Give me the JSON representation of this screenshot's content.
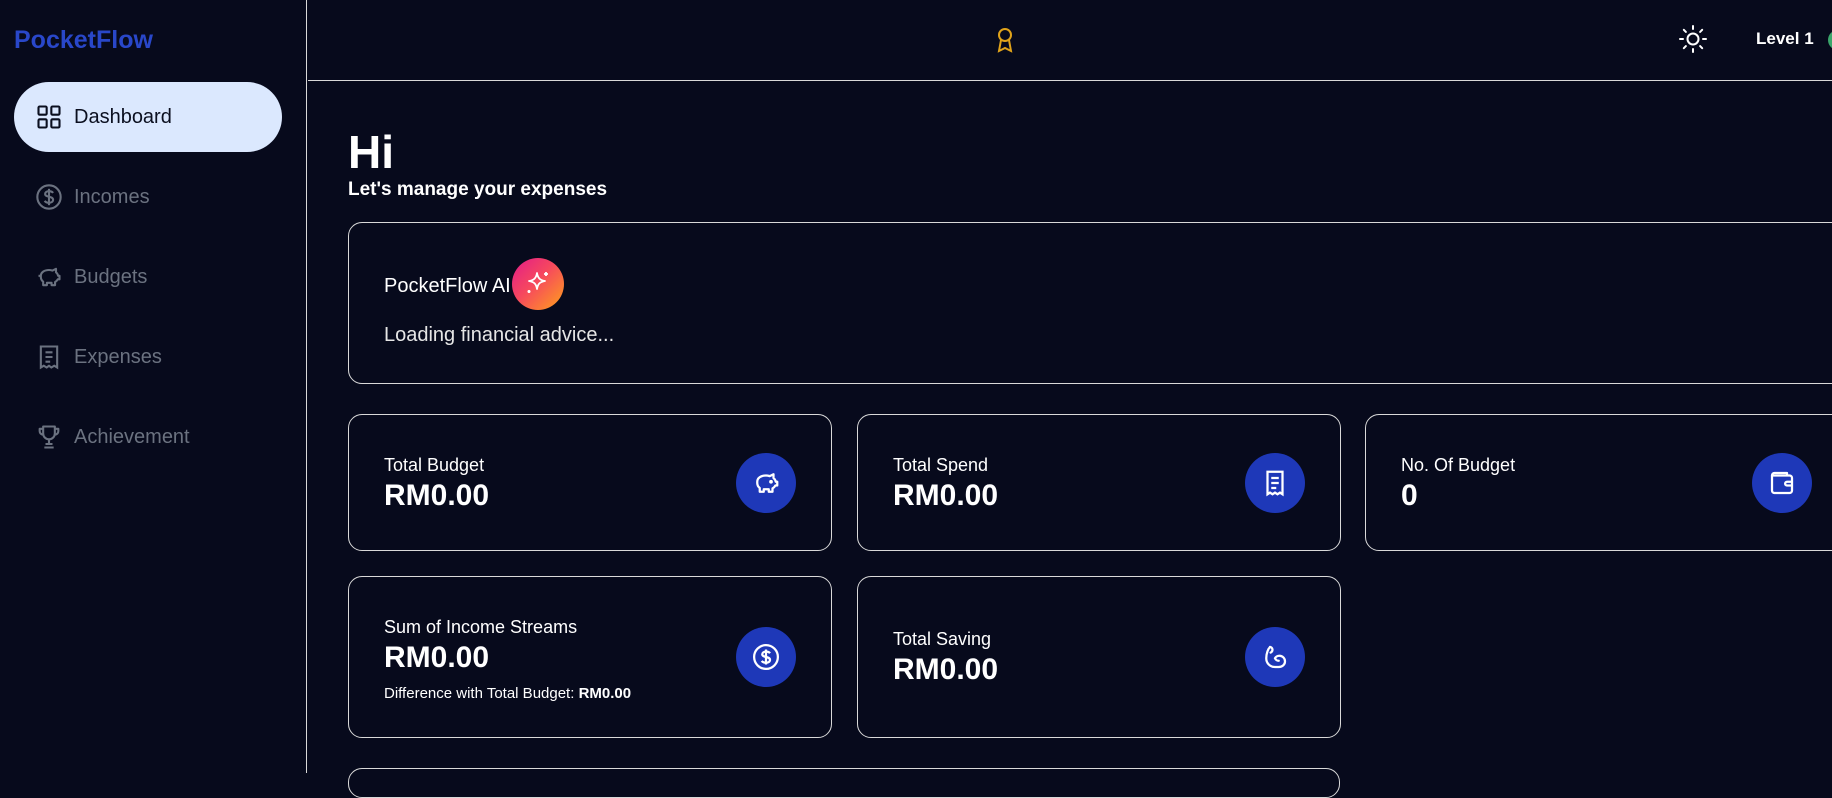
{
  "sidebar": {
    "brand": "PocketFlow",
    "items": [
      {
        "label": "Dashboard",
        "icon": "grid-icon",
        "active": true
      },
      {
        "label": "Incomes",
        "icon": "dollar-circle-icon",
        "active": false
      },
      {
        "label": "Budgets",
        "icon": "piggy-bank-icon",
        "active": false
      },
      {
        "label": "Expenses",
        "icon": "receipt-icon",
        "active": false
      },
      {
        "label": "Achievement",
        "icon": "trophy-icon",
        "active": false
      }
    ]
  },
  "topbar": {
    "badge_icon": "award-icon",
    "theme_icon": "sun-icon",
    "level": "Level 1"
  },
  "main": {
    "greeting": "Hi",
    "subtitle": "Let's manage your expenses",
    "ai": {
      "title": "PocketFlow AI",
      "icon": "sparkles-icon",
      "status": "Loading financial advice..."
    },
    "cards": {
      "total_budget": {
        "label": "Total Budget",
        "value": "RM0.00",
        "icon": "piggy-bank-icon"
      },
      "total_spend": {
        "label": "Total Spend",
        "value": "RM0.00",
        "icon": "receipt-icon"
      },
      "num_budget": {
        "label": "No. Of Budget",
        "value": "0",
        "icon": "wallet-icon"
      },
      "income_streams": {
        "label": "Sum of Income Streams",
        "value": "RM0.00",
        "note_label": "Difference with Total Budget:",
        "note_value": "RM0.00",
        "icon": "dollar-circle-icon"
      },
      "total_saving": {
        "label": "Total Saving",
        "value": "RM0.00",
        "icon": "flexed-arm-icon"
      }
    }
  },
  "colors": {
    "background": "#070a1c",
    "brand": "#2947c9",
    "active_nav": "#dbe8fe",
    "icon_circle": "#1e38b8",
    "award": "#e0a31a"
  }
}
